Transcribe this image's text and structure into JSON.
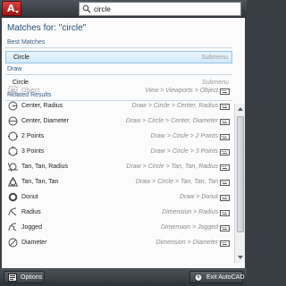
{
  "search": {
    "value": "circle"
  },
  "panel": {
    "matches_title": "Matches for: \"circle\"",
    "best_matches": {
      "header": "Best Matches",
      "item": {
        "name": "Circle",
        "type": "Submenu"
      }
    },
    "draw": {
      "header": "Draw",
      "item": {
        "name": "Circle",
        "type": "Submenu"
      }
    },
    "related": {
      "header": "Related Results",
      "items": [
        {
          "name": "Object",
          "path": "View > Viewports > Object",
          "icon": "object-icon",
          "dimmed": true
        },
        {
          "name": "Center, Radius",
          "path": "Draw > Circle > Center, Radius",
          "icon": "circle-center-radius-icon"
        },
        {
          "name": "Center, Diameter",
          "path": "Draw > Circle > Center, Diameter",
          "icon": "circle-center-diameter-icon"
        },
        {
          "name": "2 Points",
          "path": "Draw > Circle > 2 Points",
          "icon": "circle-2-points-icon"
        },
        {
          "name": "3 Points",
          "path": "Draw > Circle > 3 Points",
          "icon": "circle-3-points-icon"
        },
        {
          "name": "Tan, Tan, Radius",
          "path": "Draw > Circle > Tan, Tan, Radius",
          "icon": "circle-tan-tan-radius-icon"
        },
        {
          "name": "Tan, Tan, Tan",
          "path": "Draw > Circle > Tan, Tan, Tan",
          "icon": "circle-tan-tan-tan-icon"
        },
        {
          "name": "Donut",
          "path": "Draw > Donut",
          "icon": "donut-icon"
        },
        {
          "name": "Radius",
          "path": "Dimension > Radius",
          "icon": "dimension-radius-icon"
        },
        {
          "name": "Jogged",
          "path": "Dimension > Jogged",
          "icon": "dimension-jogged-icon"
        },
        {
          "name": "Diameter",
          "path": "Dimension > Diameter",
          "icon": "dimension-diameter-icon"
        }
      ]
    }
  },
  "footer": {
    "options_label": "Options",
    "exit_label": "Exit AutoCAD"
  },
  "colors": {
    "brand_red": "#c62828",
    "header_blue": "#365d86",
    "selection_blue": "#d2eafb"
  }
}
